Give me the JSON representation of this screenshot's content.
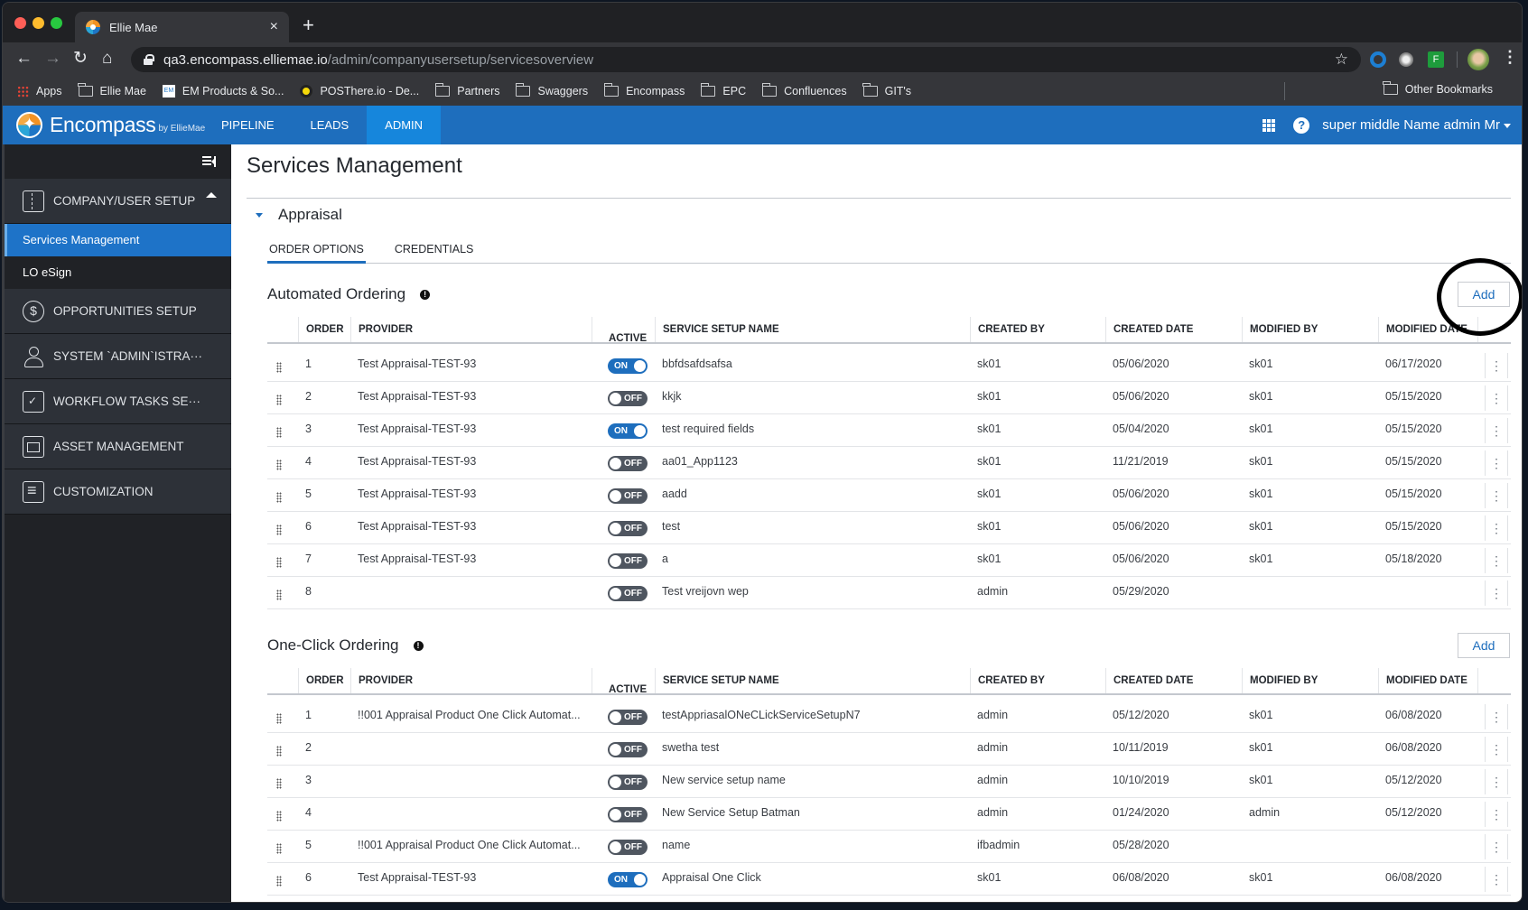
{
  "browser": {
    "tab_title": "Ellie Mae",
    "tab_close": "×",
    "new_tab": "+",
    "nav": {
      "back": "←",
      "forward": "→",
      "reload": "↻",
      "home": "⌂"
    },
    "url_host": "qa3.encompass.elliemae.io",
    "url_path": "/admin/companyusersetup/servicesoverview",
    "star": "☆",
    "ext_f_label": "F",
    "menu": "⋮",
    "bookmarks": [
      {
        "label": "Apps",
        "icon": "apps-grid-icon"
      },
      {
        "label": "Ellie Mae",
        "icon": "folder-icon"
      },
      {
        "label": "EM Products & So...",
        "icon": "em-favicon-icon"
      },
      {
        "label": "POSThere.io - De...",
        "icon": "posthere-favicon-icon"
      },
      {
        "label": "Partners",
        "icon": "folder-icon"
      },
      {
        "label": "Swaggers",
        "icon": "folder-icon"
      },
      {
        "label": "Encompass",
        "icon": "folder-icon"
      },
      {
        "label": "EPC",
        "icon": "folder-icon"
      },
      {
        "label": "Confluences",
        "icon": "folder-icon"
      },
      {
        "label": "GIT's",
        "icon": "folder-icon"
      }
    ],
    "other_bookmarks": "Other Bookmarks",
    "em_icon_text": "EM"
  },
  "app": {
    "brand": "Encompass",
    "brand_by": "by EllieMae",
    "nav": [
      {
        "label": "PIPELINE",
        "active": false
      },
      {
        "label": "LEADS",
        "active": false
      },
      {
        "label": "ADMIN",
        "active": true
      }
    ],
    "help": "?",
    "user": "super middle Name admin Mr",
    "accent": "#1e6ebd"
  },
  "sidebar": {
    "sections": [
      {
        "label": "COMPANY/USER SETUP",
        "icon": "building-user-icon",
        "expanded": true,
        "children": [
          {
            "label": "Services Management",
            "active": true
          },
          {
            "label": "LO eSign",
            "active": false
          }
        ]
      },
      {
        "label": "OPPORTUNITIES SETUP",
        "icon": "dollar-circle-icon",
        "glyph": "$"
      },
      {
        "label": "SYSTEM `ADMIN`ISTRA···",
        "icon": "person-icon"
      },
      {
        "label": "WORKFLOW TASKS SE···",
        "icon": "clipboard-check-icon"
      },
      {
        "label": "ASSET MANAGEMENT",
        "icon": "asset-image-icon"
      },
      {
        "label": "CUSTOMIZATION",
        "icon": "list-icon"
      }
    ]
  },
  "main": {
    "title": "Services Management",
    "accordion_label": "Appraisal",
    "tabs": [
      {
        "label": "ORDER OPTIONS",
        "active": true
      },
      {
        "label": "CREDENTIALS",
        "active": false
      }
    ],
    "columns": [
      "",
      "ORDER",
      "PROVIDER",
      "ACTIVE",
      "SERVICE SETUP NAME",
      "CREATED BY",
      "CREATED DATE",
      "MODIFIED BY",
      "MODIFIED DATE",
      ""
    ],
    "add_label": "Add",
    "info_glyph": "!",
    "row_menu_glyph": "⋮",
    "toggle_on": "ON",
    "toggle_off": "OFF",
    "automated": {
      "title": "Automated Ordering",
      "rows": [
        {
          "order": "1",
          "provider": "Test Appraisal-TEST-93",
          "active": true,
          "name": "bbfdsafdsafsa",
          "created_by": "sk01",
          "created_date": "05/06/2020",
          "modified_by": "sk01",
          "modified_date": "06/17/2020"
        },
        {
          "order": "2",
          "provider": "Test Appraisal-TEST-93",
          "active": false,
          "name": "kkjk",
          "created_by": "sk01",
          "created_date": "05/06/2020",
          "modified_by": "sk01",
          "modified_date": "05/15/2020"
        },
        {
          "order": "3",
          "provider": "Test Appraisal-TEST-93",
          "active": true,
          "name": "test required fields",
          "created_by": "sk01",
          "created_date": "05/04/2020",
          "modified_by": "sk01",
          "modified_date": "05/15/2020"
        },
        {
          "order": "4",
          "provider": "Test Appraisal-TEST-93",
          "active": false,
          "name": "aa01_App1123",
          "created_by": "sk01",
          "created_date": "11/21/2019",
          "modified_by": "sk01",
          "modified_date": "05/15/2020"
        },
        {
          "order": "5",
          "provider": "Test Appraisal-TEST-93",
          "active": false,
          "name": "aadd",
          "created_by": "sk01",
          "created_date": "05/06/2020",
          "modified_by": "sk01",
          "modified_date": "05/15/2020"
        },
        {
          "order": "6",
          "provider": "Test Appraisal-TEST-93",
          "active": false,
          "name": "test",
          "created_by": "sk01",
          "created_date": "05/06/2020",
          "modified_by": "sk01",
          "modified_date": "05/15/2020"
        },
        {
          "order": "7",
          "provider": "Test Appraisal-TEST-93",
          "active": false,
          "name": "a",
          "created_by": "sk01",
          "created_date": "05/06/2020",
          "modified_by": "sk01",
          "modified_date": "05/18/2020"
        },
        {
          "order": "8",
          "provider": "",
          "active": false,
          "name": "Test vreijovn wep",
          "created_by": "admin",
          "created_date": "05/29/2020",
          "modified_by": "",
          "modified_date": ""
        }
      ]
    },
    "oneclick": {
      "title": "One-Click Ordering",
      "rows": [
        {
          "order": "1",
          "provider": "!!001 Appraisal Product One Click Automat...",
          "active": false,
          "name": "testAppriasalONeCLickServiceSetupN7",
          "created_by": "admin",
          "created_date": "05/12/2020",
          "modified_by": "sk01",
          "modified_date": "06/08/2020"
        },
        {
          "order": "2",
          "provider": "",
          "active": false,
          "name": "swetha test",
          "created_by": "admin",
          "created_date": "10/11/2019",
          "modified_by": "sk01",
          "modified_date": "06/08/2020"
        },
        {
          "order": "3",
          "provider": "",
          "active": false,
          "name": "New service setup name",
          "created_by": "admin",
          "created_date": "10/10/2019",
          "modified_by": "sk01",
          "modified_date": "05/12/2020"
        },
        {
          "order": "4",
          "provider": "",
          "active": false,
          "name": "New Service Setup Batman",
          "created_by": "admin",
          "created_date": "01/24/2020",
          "modified_by": "admin",
          "modified_date": "05/12/2020"
        },
        {
          "order": "5",
          "provider": "!!001 Appraisal Product One Click Automat...",
          "active": false,
          "name": "name",
          "created_by": "ifbadmin",
          "created_date": "05/28/2020",
          "modified_by": "",
          "modified_date": ""
        },
        {
          "order": "6",
          "provider": "Test Appraisal-TEST-93",
          "active": true,
          "name": "Appraisal One Click",
          "created_by": "sk01",
          "created_date": "06/08/2020",
          "modified_by": "sk01",
          "modified_date": "06/08/2020"
        }
      ]
    }
  }
}
